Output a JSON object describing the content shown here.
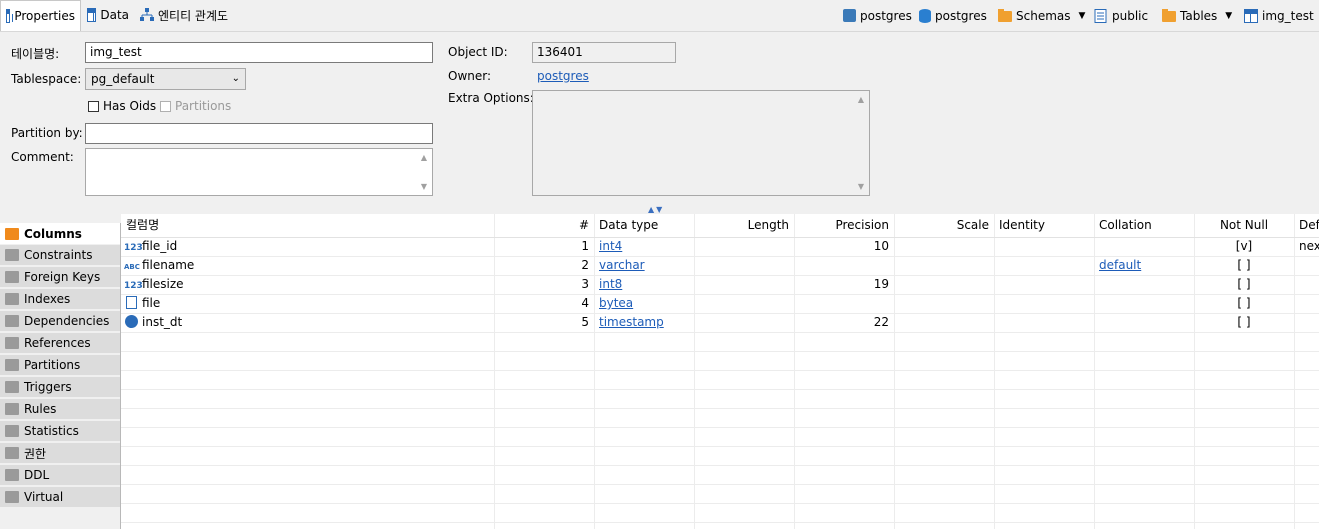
{
  "tabs": [
    {
      "label": "Properties",
      "icon": "table-icon"
    },
    {
      "label": "Data",
      "icon": "data-icon"
    },
    {
      "label": "엔티티 관계도",
      "icon": "erd-icon"
    }
  ],
  "breadcrumb": [
    {
      "label": "postgres",
      "icon": "server-icon"
    },
    {
      "label": "postgres",
      "icon": "database-icon"
    },
    {
      "label": "Schemas",
      "icon": "folder-icon"
    },
    {
      "label": "public",
      "icon": "schema-icon"
    },
    {
      "label": "Tables",
      "icon": "folder-icon"
    },
    {
      "label": "img_test",
      "icon": "table-icon"
    }
  ],
  "form": {
    "table_name_label": "테이블명:",
    "table_name_value": "img_test",
    "tablespace_label": "Tablespace:",
    "tablespace_value": "pg_default",
    "has_oids_label": "Has Oids",
    "partitions_label": "Partitions",
    "partition_by_label": "Partition by:",
    "partition_by_value": "",
    "comment_label": "Comment:",
    "comment_value": "",
    "object_id_label": "Object ID:",
    "object_id_value": "136401",
    "owner_label": "Owner:",
    "owner_value": "postgres",
    "extra_options_label": "Extra Options:"
  },
  "side_tabs": [
    {
      "label": "Columns",
      "active": true
    },
    {
      "label": "Constraints"
    },
    {
      "label": "Foreign Keys"
    },
    {
      "label": "Indexes"
    },
    {
      "label": "Dependencies"
    },
    {
      "label": "References"
    },
    {
      "label": "Partitions"
    },
    {
      "label": "Triggers"
    },
    {
      "label": "Rules"
    },
    {
      "label": "Statistics"
    },
    {
      "label": "권한"
    },
    {
      "label": "DDL"
    },
    {
      "label": "Virtual"
    }
  ],
  "grid": {
    "headers": [
      "컬럼명",
      "#",
      "Data type",
      "Length",
      "Precision",
      "Scale",
      "Identity",
      "Collation",
      "Not Null",
      "Def"
    ],
    "rows": [
      {
        "icon": "123",
        "name": "file_id",
        "num": "1",
        "type": "int4",
        "length": "",
        "precision": "10",
        "scale": "",
        "identity": "",
        "collation": "",
        "not_null": "[v]",
        "default": "nex"
      },
      {
        "icon": "ABC",
        "name": "filename",
        "num": "2",
        "type": "varchar",
        "length": "",
        "precision": "",
        "scale": "",
        "identity": "",
        "collation": "default",
        "not_null": "[ ]",
        "default": ""
      },
      {
        "icon": "123",
        "name": "filesize",
        "num": "3",
        "type": "int8",
        "length": "",
        "precision": "19",
        "scale": "",
        "identity": "",
        "collation": "",
        "not_null": "[ ]",
        "default": ""
      },
      {
        "icon": "file",
        "name": "file",
        "num": "4",
        "type": "bytea",
        "length": "",
        "precision": "",
        "scale": "",
        "identity": "",
        "collation": "",
        "not_null": "[ ]",
        "default": ""
      },
      {
        "icon": "clock",
        "name": "inst_dt",
        "num": "5",
        "type": "timestamp",
        "length": "",
        "precision": "22",
        "scale": "",
        "identity": "",
        "collation": "",
        "not_null": "[ ]",
        "default": ""
      }
    ]
  },
  "colors": {
    "accent": "#2a6bb8",
    "link": "#1d5cb8",
    "folder": "#f0a030"
  }
}
